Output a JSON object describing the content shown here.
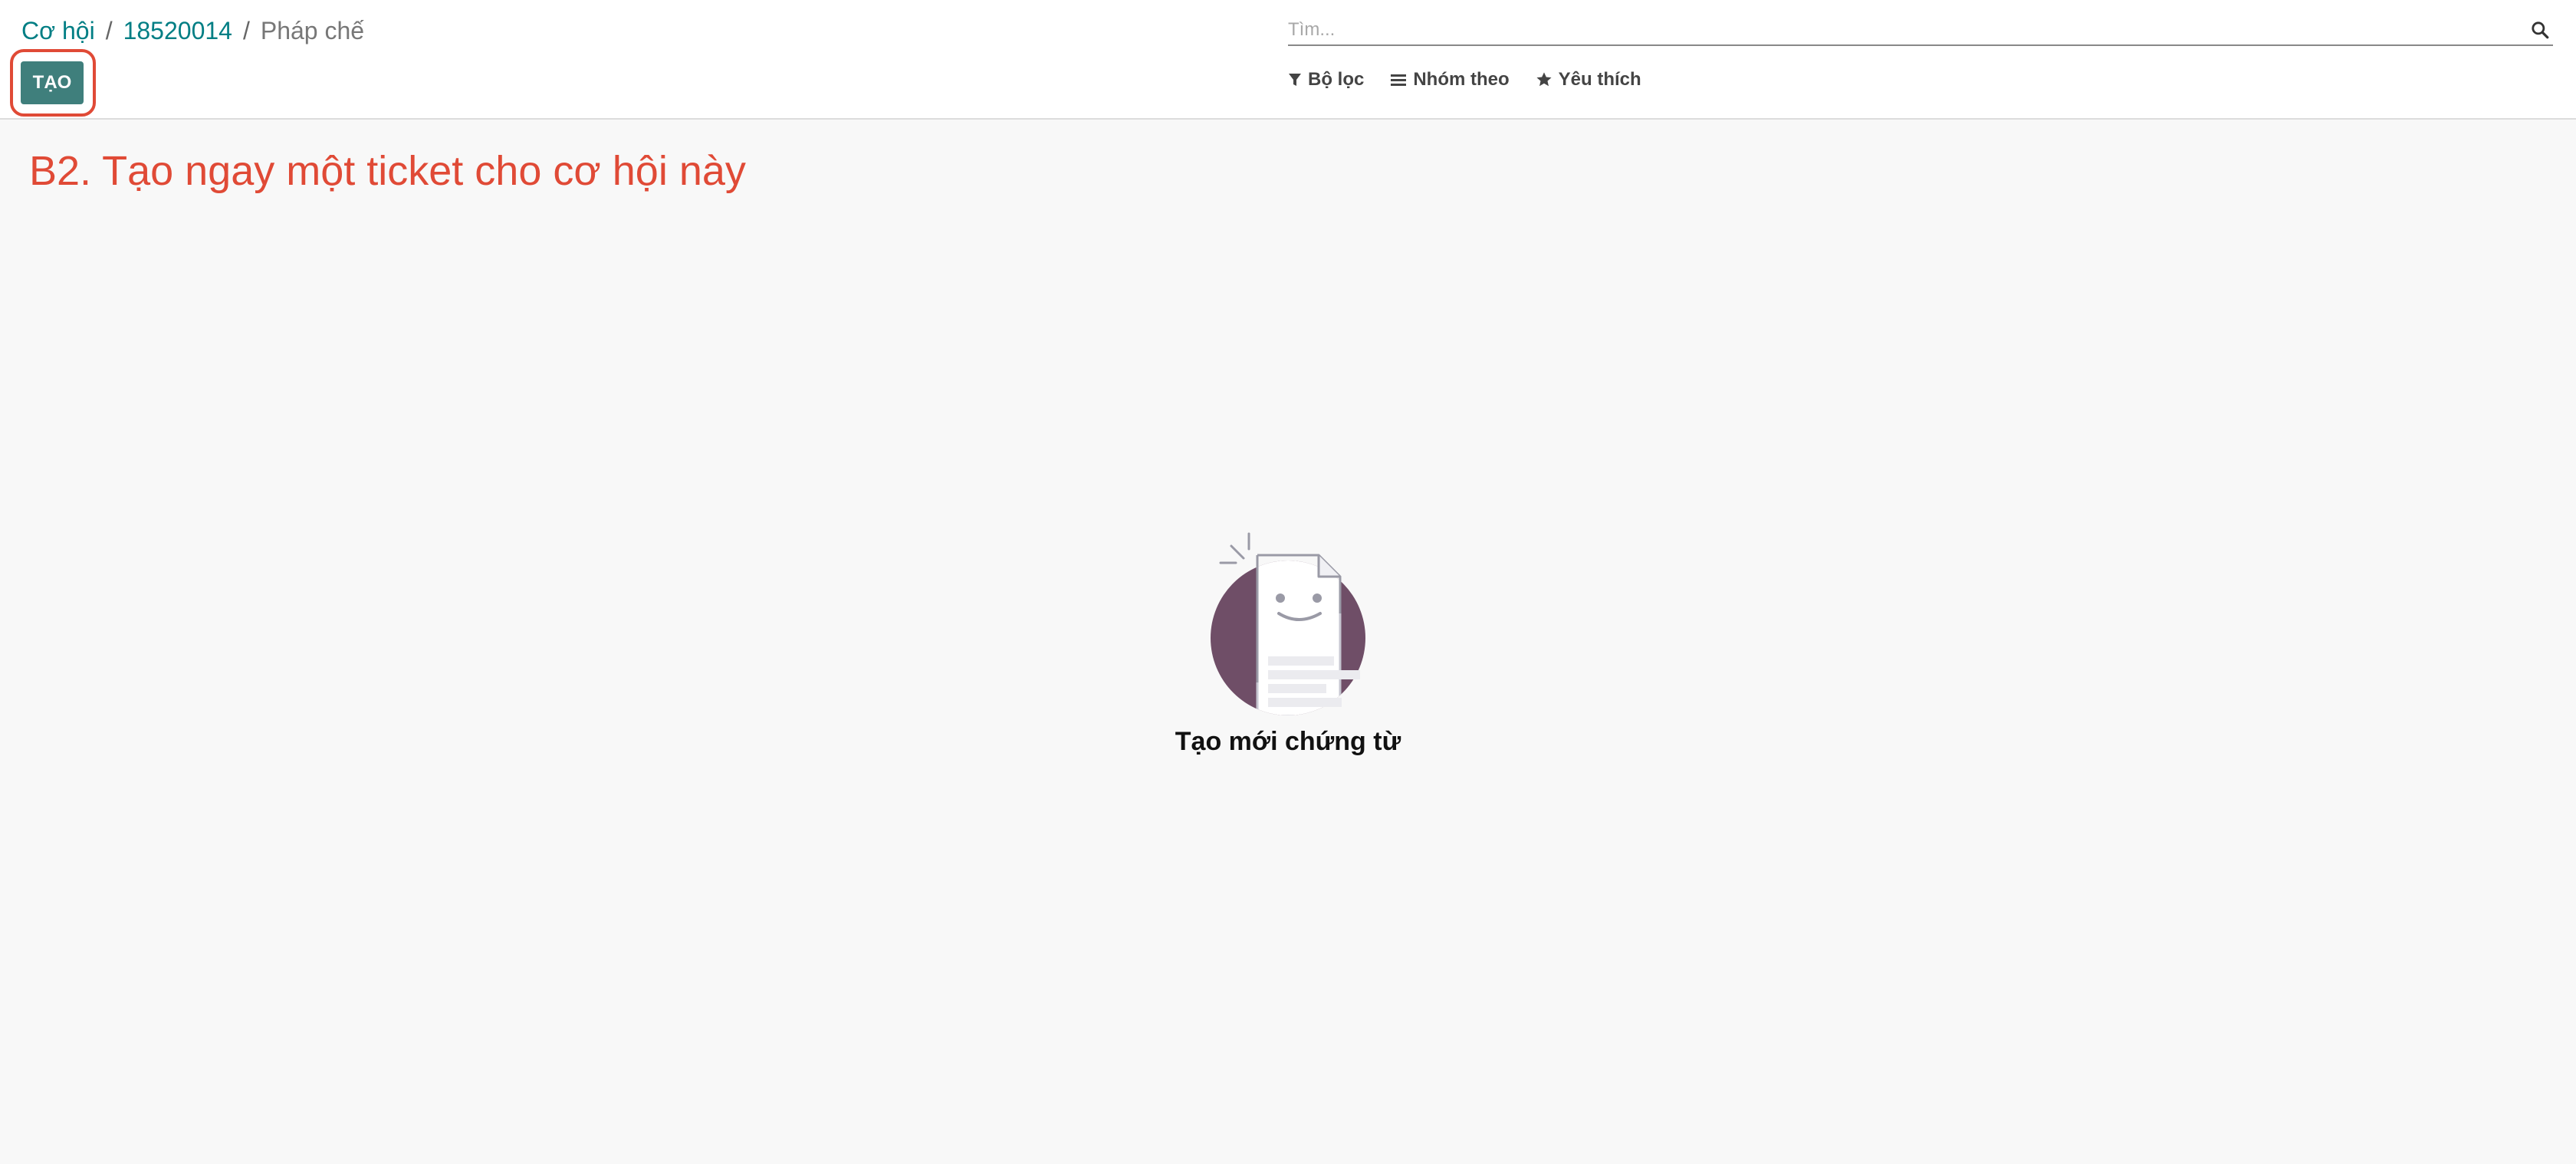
{
  "breadcrumb": {
    "items": [
      "Cơ hội",
      "18520014"
    ],
    "separator": "/",
    "current": "Pháp chế"
  },
  "toolbar": {
    "create_label": "TẠO"
  },
  "search": {
    "placeholder": "Tìm...",
    "icon": "search-icon"
  },
  "search_options": {
    "filters_label": "Bộ lọc",
    "group_by_label": "Nhóm theo",
    "favorites_label": "Yêu thích"
  },
  "annotation": {
    "text": "B2. Tạo ngay một ticket cho cơ hội này",
    "color": "#e04a36"
  },
  "helper": {
    "title": "Tạo mới chứng từ"
  },
  "colors": {
    "brand": "#017e84",
    "create_button": "#3f7f7c",
    "illustration_circle": "#6f4e67"
  }
}
